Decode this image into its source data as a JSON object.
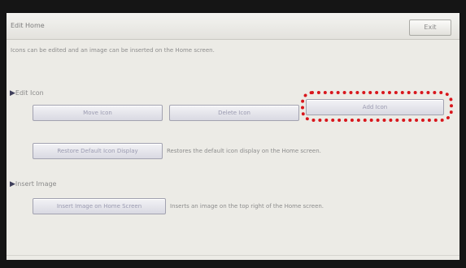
{
  "window": {
    "title": "Edit Home",
    "exit_label": "Exit"
  },
  "description": "Icons can be edited and an image can be inserted on the Home screen.",
  "edit_icons": {
    "heading": "Edit Icon",
    "move_label": "Move Icon",
    "delete_label": "Delete Icon",
    "add_label": "Add Icon",
    "restore_label": "Restore Default Icon Display",
    "restore_text": "Restores the default icon display on the Home screen."
  },
  "insert_image": {
    "heading": "Insert Image",
    "insert_label": "Insert Image on Home Screen",
    "insert_text": "Inserts an image on the top right of the Home screen."
  },
  "colors": {
    "highlight": "#d8161c"
  }
}
